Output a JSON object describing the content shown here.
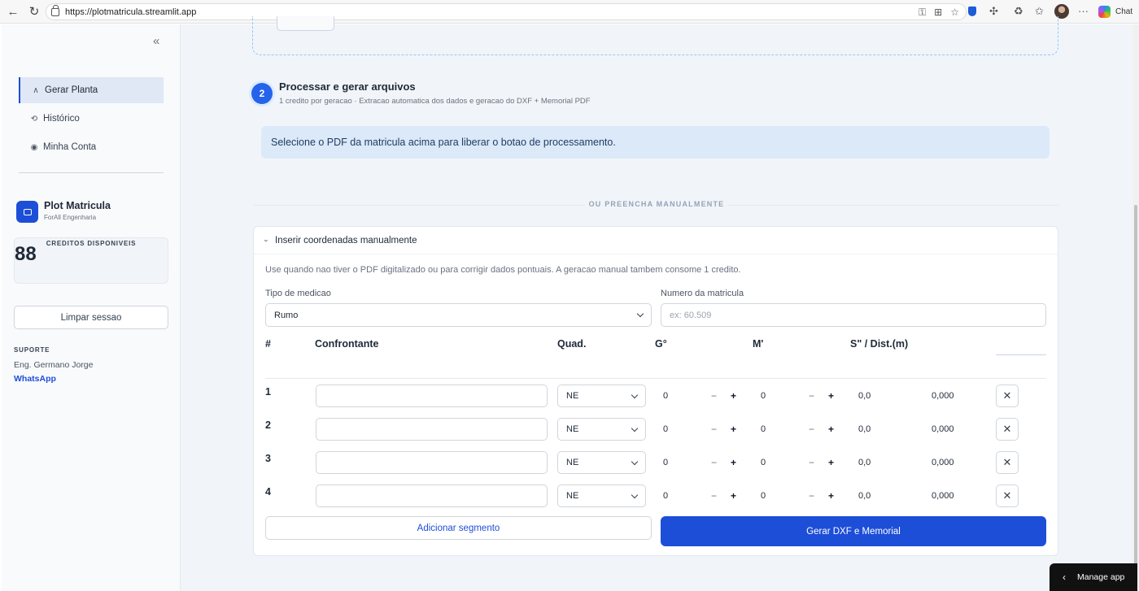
{
  "browser": {
    "url": "https://plotmatricula.streamlit.app",
    "chat_label": "Chat"
  },
  "sidebar": {
    "collapse_icon": "double-chevron-left-icon",
    "nav": [
      {
        "label": "Gerar Planta",
        "icon": "chevron-up-icon",
        "active": true
      },
      {
        "label": "Histórico",
        "icon": "history-icon",
        "active": false
      },
      {
        "label": "Minha Conta",
        "icon": "user-circle-icon",
        "active": false
      }
    ],
    "brand": {
      "name": "Plot Matricula",
      "subtitle": "ForAll Engenharia"
    },
    "credits": {
      "value": "88",
      "label": "CREDITOS DISPONIVEIS"
    },
    "clear_label": "Limpar sessao",
    "support": {
      "title": "SUPORTE",
      "name": "Eng. Germano Jorge",
      "link": "WhatsApp"
    }
  },
  "step": {
    "number": "2",
    "title": "Processar e gerar arquivos",
    "subtitle": "1 credito por geracao · Extracao automatica dos dados e geracao do DXF + Memorial PDF",
    "info": "Selecione o PDF da matricula acima para liberar o botao de processamento."
  },
  "divider_label": "OU PREENCHA MANUALMENTE",
  "manual": {
    "expander_label": "Inserir coordenadas manualmente",
    "description": "Use quando nao tiver o PDF digitalizado ou para corrigir dados pontuais. A geracao manual tambem consome 1 credito.",
    "tipo_label": "Tipo de medicao",
    "tipo_value": "Rumo",
    "matricula_label": "Numero da matricula",
    "matricula_placeholder": "ex: 60.509",
    "headers": {
      "num": "#",
      "confrontante": "Confrontante",
      "quad": "Quad.",
      "graus": "G°",
      "minutos": "M'",
      "segundos_dist": "S\" / Dist.(m)"
    },
    "rows": [
      {
        "n": "1",
        "quad": "NE",
        "g": "0",
        "m": "0",
        "s": "0,0",
        "dist": "0,000"
      },
      {
        "n": "2",
        "quad": "NE",
        "g": "0",
        "m": "0",
        "s": "0,0",
        "dist": "0,000"
      },
      {
        "n": "3",
        "quad": "NE",
        "g": "0",
        "m": "0",
        "s": "0,0",
        "dist": "0,000"
      },
      {
        "n": "4",
        "quad": "NE",
        "g": "0",
        "m": "0",
        "s": "0,0",
        "dist": "0,000"
      }
    ],
    "stepper": {
      "minus": "−",
      "plus": "+"
    },
    "delete_glyph": "✕",
    "add_label": "Adicionar segmento",
    "generate_label": "Gerar DXF e Memorial"
  },
  "manage_app_label": "Manage app",
  "colors": {
    "accent": "#1d4ed8",
    "info_bg": "#dbe9f8",
    "main_bg": "#f1f5f9"
  }
}
